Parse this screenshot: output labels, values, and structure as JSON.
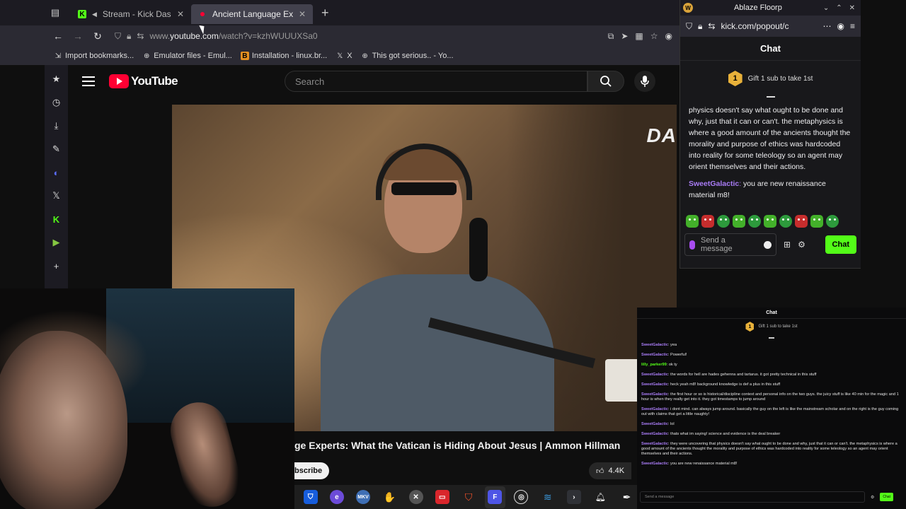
{
  "browser": {
    "tabs": [
      {
        "title": "Stream - Kick Dashboard"
      },
      {
        "title": "Ancient Language Experts"
      }
    ],
    "url_prefix": "www.",
    "url_domain": "youtube.com",
    "url_rest": "/watch?v=kzhWUUUXSa0",
    "bookmarks": [
      "Import bookmarks...",
      "Emulator files - Emul...",
      "Installation - linux.br...",
      "X",
      "This got serious.. - Yo..."
    ]
  },
  "youtube": {
    "logo_text": "YouTube",
    "search_placeholder": "Search",
    "video_watermark": "DANI",
    "video_title": "ge Experts: What the Vatican is Hiding About Jesus | Ammon Hillman",
    "subscribe_label": "bscribe",
    "likes": "4.4K"
  },
  "kick_popout": {
    "window_title": "Ablaze Floorp",
    "url": "kick.com/popout/c",
    "chat_heading": "Chat",
    "gift_badge": "1",
    "gift_text": "Gift 1 sub to take 1st",
    "messages": [
      {
        "user": "",
        "text": "physics doesn't say what ought to be done and why, just that it can or can't. the metaphysics is where a good amount of the ancients thought the morality and purpose of ethics was hardcoded into reality for some teleology so an agent may orient themselves and their actions."
      },
      {
        "user": "SweetGalactic",
        "text": " you are new renaissance material m8!"
      }
    ],
    "input_placeholder": "Send a message",
    "chat_button": "Chat"
  },
  "chat_overlay": {
    "heading": "Chat",
    "gift_badge": "1",
    "gift_text": "Gift 1 sub to take 1st",
    "messages": [
      {
        "user": "SweetGalactic",
        "text": " yea"
      },
      {
        "user": "SweetGalactic",
        "text": " Powerful!"
      },
      {
        "user": "lilly_parker99",
        "text": " ok ty"
      },
      {
        "user": "SweetGalactic",
        "text": " the words for hell are hades gehenna and tartarus. it got pretty technical in this stuff"
      },
      {
        "user": "SweetGalactic",
        "text": " heck yeah m8! background knowledge is def a plus in this stuff"
      },
      {
        "user": "SweetGalactic",
        "text": " the first hour or so is historical/discipline context and personal info on the two guys. the juicy stuff is like 40 min for the magic and 1 hour is when they really get into it. they got timestamps to jump around"
      },
      {
        "user": "SweetGalactic",
        "text": " i dont mind. can always jump around. basically the guy on the left is like the mainstream scholar and on the right is the guy coming out with claims that get a little naughty!"
      },
      {
        "user": "SweetGalactic",
        "text": " lol"
      },
      {
        "user": "SweetGalactic",
        "text": " thats what im saying! science and evidence is the deal breaker"
      },
      {
        "user": "SweetGalactic",
        "text": " they were uncovering that physics doesn't say what ought to be done and why, just that it can or can't. the metaphysics is where a good amount of the ancients thought the morality and purpose of ethics was hardcoded into reality for some teleology so an agent may orient themselves and their actions."
      },
      {
        "user": "SweetGalactic",
        "text": " you are new renaissance material m8!"
      }
    ],
    "input_placeholder": "Send a message",
    "chat_button": "Chat"
  },
  "colors": {
    "kick_green": "#53fc18",
    "youtube_red": "#ff0033",
    "username_purple": "#a97cf6"
  }
}
